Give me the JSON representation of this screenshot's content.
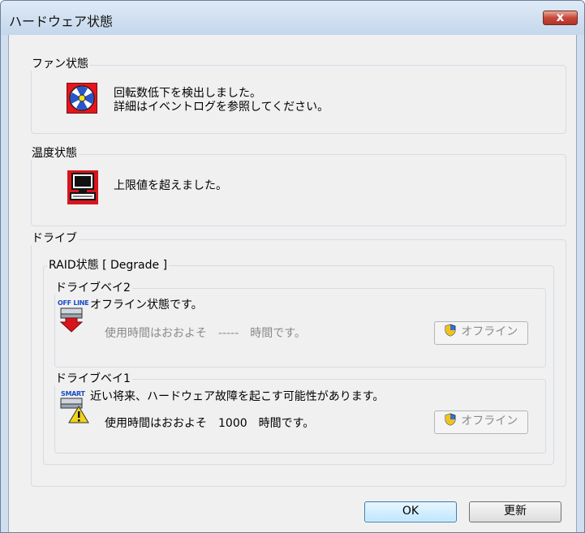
{
  "window": {
    "title": "ハードウェア状態",
    "close_label": "x"
  },
  "fan": {
    "group_label": "ファン状態",
    "message_line1": "回転数低下を検出しました。",
    "message_line2": "詳細はイベントログを参照してください。"
  },
  "temperature": {
    "group_label": "温度状態",
    "message": "上限値を超えました。"
  },
  "drive": {
    "group_label": "ドライブ",
    "raid_label": "RAID状態 [ Degrade ]",
    "bay2": {
      "label": "ドライブベイ2",
      "icon_badge": "OFF LINE",
      "status": "オフライン状態です。",
      "usage": "使用時間はおおよそ　-----　時間です。",
      "offline_button": "オフライン"
    },
    "bay1": {
      "label": "ドライブベイ1",
      "icon_badge": "SMART",
      "status": "近い将来、ハードウェア故障を起こす可能性があります。",
      "usage": "使用時間はおおよそ　1000　時間です。",
      "offline_button": "オフライン"
    }
  },
  "buttons": {
    "ok": "OK",
    "refresh": "更新"
  },
  "colors": {
    "fan_icon_bg": "#e8141c",
    "fan_blade": "#2a55c8",
    "fan_hub": "#f0e020",
    "alert_red": "#d8151c",
    "shield_blue": "#3a6fc9",
    "shield_yellow": "#f2c21a"
  }
}
